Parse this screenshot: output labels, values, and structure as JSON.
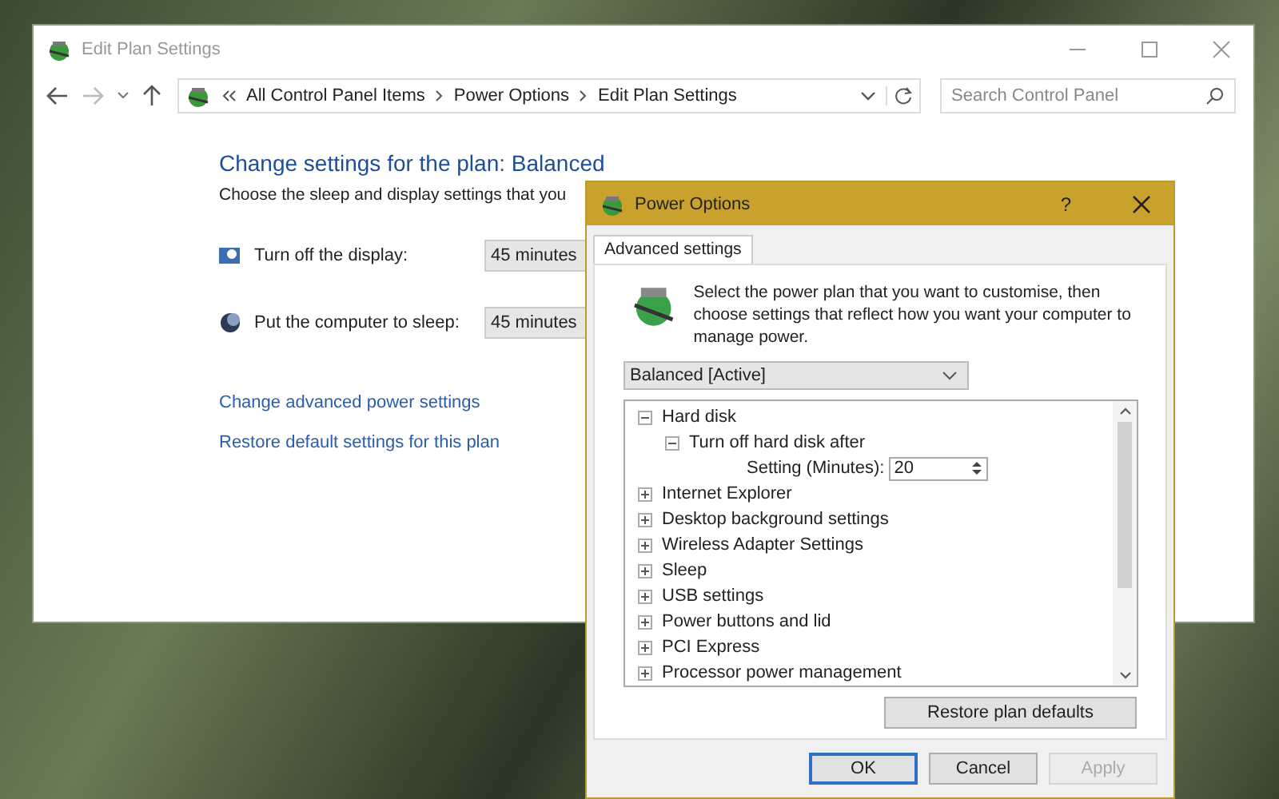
{
  "main_window": {
    "title": "Edit Plan Settings",
    "breadcrumb": [
      "All Control Panel Items",
      "Power Options",
      "Edit Plan Settings"
    ],
    "search": {
      "placeholder": "Search Control Panel"
    },
    "heading": "Change settings for the plan: Balanced",
    "description": "Choose the sleep and display settings that you",
    "settings": [
      {
        "kind": "display",
        "label": "Turn off the display:",
        "value": "45 minutes"
      },
      {
        "kind": "sleep",
        "label": "Put the computer to sleep:",
        "value": "45 minutes"
      }
    ],
    "links": [
      "Change advanced power settings",
      "Restore default settings for this plan"
    ]
  },
  "dialog": {
    "title": "Power Options",
    "help": "?",
    "tabs": [
      {
        "label": "Advanced settings",
        "selected": true
      }
    ],
    "description": "Select the power plan that you want to customise, then choose settings that reflect how you want your computer to manage power.",
    "plan": "Balanced [Active]",
    "tree": [
      {
        "kind": "group",
        "label": "Hard disk",
        "expanded": true,
        "children": [
          {
            "kind": "group",
            "label": "Turn off hard disk after",
            "expanded": true,
            "children": [
              {
                "kind": "setting",
                "label": "Setting (Minutes):",
                "value": "20"
              }
            ]
          }
        ]
      },
      {
        "kind": "group",
        "label": "Internet Explorer",
        "expanded": false
      },
      {
        "kind": "group",
        "label": "Desktop background settings",
        "expanded": false
      },
      {
        "kind": "group",
        "label": "Wireless Adapter Settings",
        "expanded": false
      },
      {
        "kind": "group",
        "label": "Sleep",
        "expanded": false
      },
      {
        "kind": "group",
        "label": "USB settings",
        "expanded": false
      },
      {
        "kind": "group",
        "label": "Power buttons and lid",
        "expanded": false
      },
      {
        "kind": "group",
        "label": "PCI Express",
        "expanded": false
      },
      {
        "kind": "group",
        "label": "Processor power management",
        "expanded": false
      }
    ],
    "restore_button": "Restore plan defaults",
    "buttons": [
      {
        "label": "OK",
        "default": true,
        "disabled": false
      },
      {
        "label": "Cancel",
        "default": false,
        "disabled": false
      },
      {
        "label": "Apply",
        "default": false,
        "disabled": true
      }
    ]
  }
}
